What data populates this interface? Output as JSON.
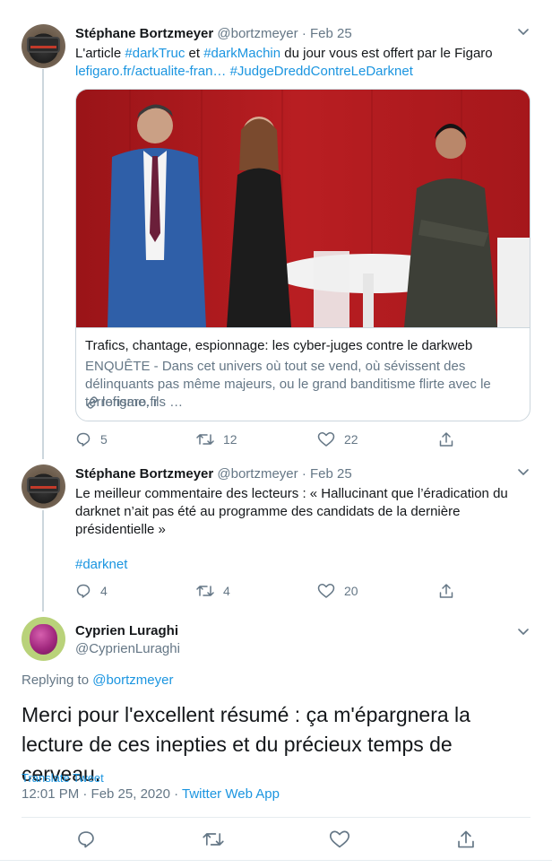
{
  "tweet1": {
    "name": "Stéphane Bortzmeyer",
    "handle": "@bortzmeyer",
    "dot": "·",
    "date": "Feb 25",
    "text_parts": [
      "L'article ",
      "#darkTruc",
      " et ",
      "#darkMachin",
      " du jour vous est offert par le Figaro"
    ],
    "link_url": "lefigaro.fr/actualite-fran…",
    "link_hashtag": "#JudgeDreddContreLeDarknet",
    "card": {
      "title": "Trafics, chantage, espionnage: les cyber-juges contre le darkweb",
      "description": "ENQUÊTE - Dans cet univers où tout se vend, où sévissent des délinquants pas même majeurs, ou le grand banditisme flirte avec le terrorisme, ils …",
      "domain": "lefigaro.fr"
    },
    "replies": "5",
    "retweets": "12",
    "likes": "22"
  },
  "tweet2": {
    "name": "Stéphane Bortzmeyer",
    "handle": "@bortzmeyer",
    "dot": "·",
    "date": "Feb 25",
    "text": "Le meilleur commentaire des lecteurs : « Hallucinant que l’éradication du darknet n’ait pas été au programme des candidats de la dernière présidentielle »",
    "hashtag": "#darknet",
    "replies": "4",
    "retweets": "4",
    "likes": "20"
  },
  "main": {
    "name": "Cyprien Luraghi",
    "handle": "@CyprienLuraghi",
    "replying_prefix": "Replying to ",
    "replying_to": "@bortzmeyer",
    "text": "Merci pour l'excellent résumé : ça m'épargnera la lecture de ces inepties et du précieux temps de cerveau.",
    "translate": "Translate Tweet",
    "time": "12:01 PM · Feb 25, 2020 · ",
    "app": "Twitter Web App"
  },
  "icons": {
    "reply": "reply-icon",
    "retweet": "retweet-icon",
    "like": "heart-icon",
    "share": "share-icon",
    "more": "chevron-down-icon",
    "link": "link-icon"
  },
  "colors": {
    "accent": "#1b95e0",
    "secondary_text": "#657786",
    "border": "#ccd6dd",
    "card_background": "#a8171c"
  }
}
